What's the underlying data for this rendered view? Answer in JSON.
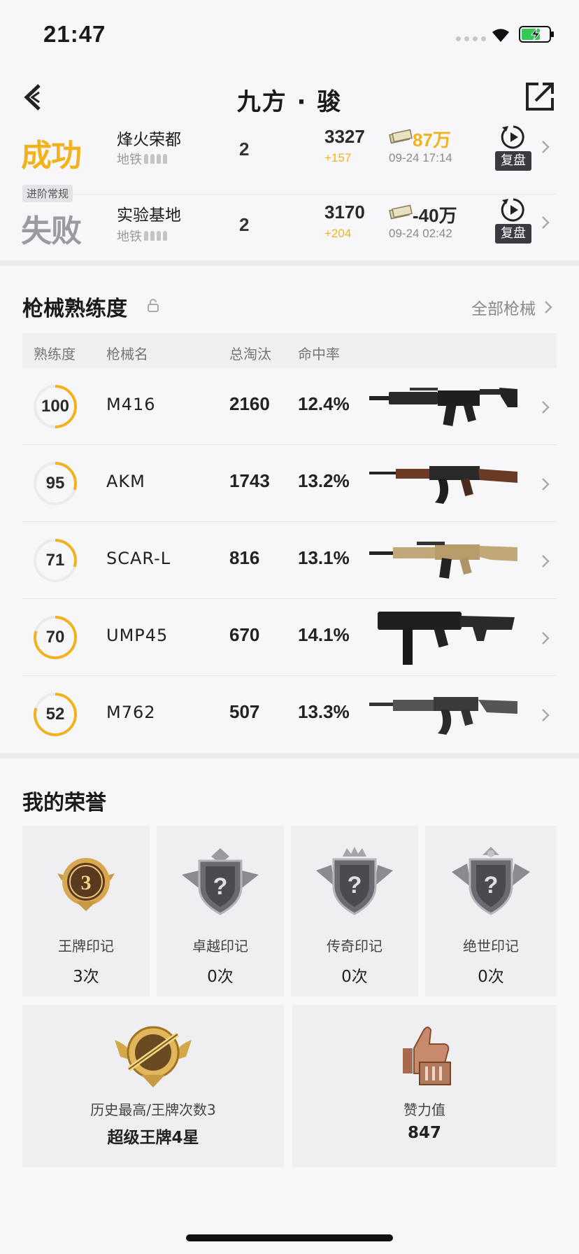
{
  "status_bar": {
    "time": "21:47"
  },
  "header": {
    "title": "九方 · 骏"
  },
  "matches": [
    {
      "tag": "",
      "result": "成功",
      "map": "烽火荣都",
      "mode": "地铁",
      "squad_size": "2",
      "rating": "3327",
      "rating_delta": "+157",
      "cash": "87万",
      "time": "09-24 17:14",
      "replay_label": "复盘"
    },
    {
      "tag": "进阶常规",
      "result": "失败",
      "map": "实验基地",
      "mode": "地铁",
      "squad_size": "2",
      "rating": "3170",
      "rating_delta": "+204",
      "cash": "-40万",
      "time": "09-24 02:42",
      "replay_label": "复盘"
    }
  ],
  "weapons_section": {
    "title": "枪械熟练度",
    "all_link": "全部枪械",
    "columns": [
      "熟练度",
      "枪械名",
      "总淘汰",
      "命中率"
    ],
    "rows": [
      {
        "proficiency": "100",
        "progress": 0.5,
        "name": "M416",
        "kills": "2160",
        "hit_rate": "12.4%",
        "icon": "m416-rifle-icon"
      },
      {
        "proficiency": "95",
        "progress": 0.3,
        "name": "AKM",
        "kills": "1743",
        "hit_rate": "13.2%",
        "icon": "akm-rifle-icon"
      },
      {
        "proficiency": "71",
        "progress": 0.3,
        "name": "SCAR-L",
        "kills": "816",
        "hit_rate": "13.1%",
        "icon": "scar-l-rifle-icon"
      },
      {
        "proficiency": "70",
        "progress": 0.8,
        "name": "UMP45",
        "kills": "670",
        "hit_rate": "14.1%",
        "icon": "ump45-smg-icon"
      },
      {
        "proficiency": "52",
        "progress": 0.8,
        "name": "M762",
        "kills": "507",
        "hit_rate": "13.3%",
        "icon": "m762-rifle-icon"
      }
    ]
  },
  "honors_section": {
    "title": "我的荣誉",
    "marks": [
      {
        "label": "王牌印记",
        "value": "3次",
        "badge_number": "3",
        "icon": "ace-mark-badge-icon"
      },
      {
        "label": "卓越印记",
        "value": "0次",
        "icon": "excellence-mark-badge-icon"
      },
      {
        "label": "传奇印记",
        "value": "0次",
        "icon": "legend-mark-badge-icon"
      },
      {
        "label": "绝世印记",
        "value": "0次",
        "icon": "peerless-mark-badge-icon"
      }
    ],
    "highest": {
      "label": "历史最高/王牌次数3",
      "value": "超级王牌4星",
      "icon": "super-ace-badge-icon"
    },
    "likes": {
      "label": "赞力值",
      "value": "847",
      "icon": "thumbs-up-trophy-icon"
    }
  },
  "colors": {
    "accent": "#f2b21e",
    "fail_gray": "#9a9aa0",
    "background": "#f7f7f9"
  }
}
